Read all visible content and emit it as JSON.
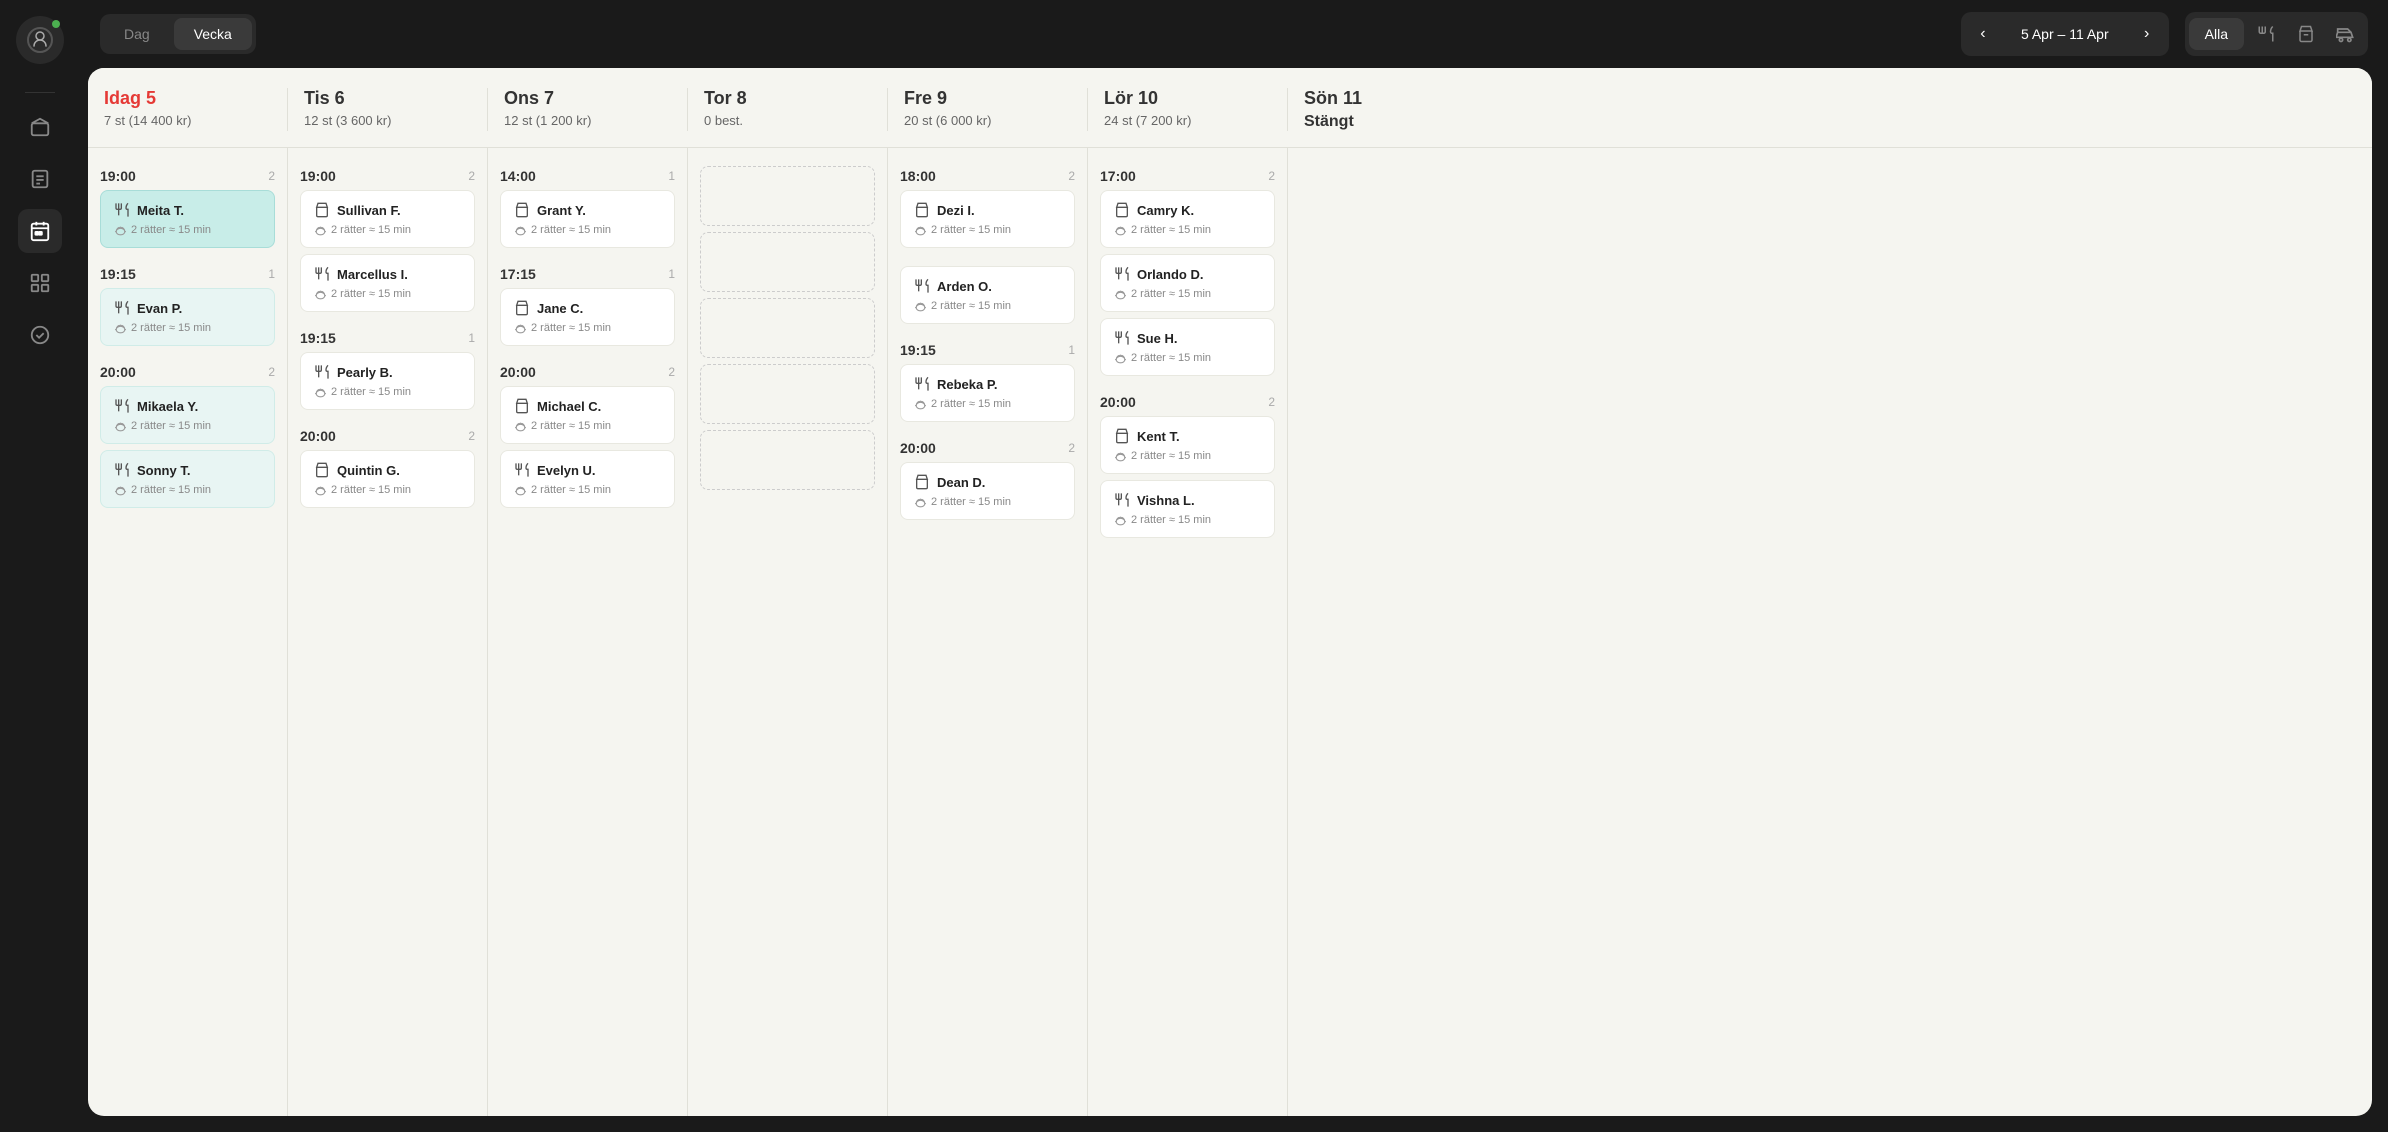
{
  "sidebar": {
    "logo_alt": "App Logo",
    "items": [
      {
        "id": "home",
        "icon": "home",
        "label": "Home",
        "active": false
      },
      {
        "id": "orders",
        "icon": "orders",
        "label": "Orders",
        "active": false
      },
      {
        "id": "calendar",
        "icon": "calendar",
        "label": "Calendar",
        "active": true
      },
      {
        "id": "grid",
        "icon": "grid",
        "label": "Grid",
        "active": false
      },
      {
        "id": "tasks",
        "icon": "tasks",
        "label": "Tasks",
        "active": false
      }
    ]
  },
  "topbar": {
    "view_dag": "Dag",
    "view_vecka": "Vecka",
    "date_range": "5 Apr – 11 Apr",
    "nav_prev": "‹",
    "nav_next": "›",
    "filter_alla": "Alla"
  },
  "days": [
    {
      "id": "mon",
      "name": "Idag 5",
      "today": true,
      "stats": "7 st (14 400 kr)",
      "slots": [
        {
          "time": "19:00",
          "count": 2,
          "reservations": [
            {
              "name": "Meita T.",
              "details": "2 rätter ≈ 15 min",
              "icon": "cutlery",
              "style": "highlighted"
            }
          ]
        },
        {
          "time": "19:15",
          "count": 1,
          "reservations": [
            {
              "name": "Evan P.",
              "details": "2 rätter ≈ 15 min",
              "icon": "cutlery",
              "style": "teal"
            }
          ]
        },
        {
          "time": "20:00",
          "count": 2,
          "reservations": [
            {
              "name": "Mikaela Y.",
              "details": "2 rätter ≈ 15 min",
              "icon": "cutlery",
              "style": "teal"
            },
            {
              "name": "Sonny T.",
              "details": "2 rätter ≈ 15 min",
              "icon": "cutlery",
              "style": "teal"
            }
          ]
        }
      ]
    },
    {
      "id": "tue",
      "name": "Tis 6",
      "today": false,
      "stats": "12 st (3 600 kr)",
      "slots": [
        {
          "time": "19:00",
          "count": 2,
          "reservations": [
            {
              "name": "Sullivan F.",
              "details": "2 rätter ≈ 15 min",
              "icon": "bag",
              "style": "default"
            },
            {
              "name": "Marcellus I.",
              "details": "2 rätter ≈ 15 min",
              "icon": "cutlery",
              "style": "default"
            }
          ]
        },
        {
          "time": "19:15",
          "count": 1,
          "reservations": [
            {
              "name": "Pearly B.",
              "details": "2 rätter ≈ 15 min",
              "icon": "cutlery",
              "style": "default"
            }
          ]
        },
        {
          "time": "20:00",
          "count": 2,
          "reservations": [
            {
              "name": "Quintin G.",
              "details": "2 rätter ≈ 15 min",
              "icon": "bag",
              "style": "default"
            }
          ]
        }
      ]
    },
    {
      "id": "wed",
      "name": "Ons 7",
      "today": false,
      "stats": "12 st (1 200 kr)",
      "slots": [
        {
          "time": "14:00",
          "count": 1,
          "reservations": [
            {
              "name": "Grant Y.",
              "details": "2 rätter ≈ 15 min",
              "icon": "bag",
              "style": "default"
            }
          ]
        },
        {
          "time": "17:15",
          "count": 1,
          "reservations": [
            {
              "name": "Jane C.",
              "details": "2 rätter ≈ 15 min",
              "icon": "bag",
              "style": "default"
            }
          ]
        },
        {
          "time": "20:00",
          "count": 2,
          "reservations": [
            {
              "name": "Michael C.",
              "details": "2 rätter ≈ 15 min",
              "icon": "bag",
              "style": "default"
            },
            {
              "name": "Evelyn U.",
              "details": "2 rätter ≈ 15 min",
              "icon": "cutlery",
              "style": "default"
            }
          ]
        }
      ]
    },
    {
      "id": "thu",
      "name": "Tor 8",
      "today": false,
      "stats": "0 best.",
      "slots": []
    },
    {
      "id": "fri",
      "name": "Fre 9",
      "today": false,
      "stats": "20 st (6 000 kr)",
      "slots": [
        {
          "time": "18:00",
          "count": 2,
          "reservations": [
            {
              "name": "Dezi I.",
              "details": "2 rätter ≈ 15 min",
              "icon": "bag",
              "style": "default"
            }
          ]
        },
        {
          "time": null,
          "count": null,
          "reservations": [
            {
              "name": "Arden O.",
              "details": "2 rätter ≈ 15 min",
              "icon": "cutlery",
              "style": "default"
            }
          ]
        },
        {
          "time": "19:15",
          "count": 1,
          "reservations": [
            {
              "name": "Rebeka P.",
              "details": "2 rätter ≈ 15 min",
              "icon": "cutlery",
              "style": "default"
            }
          ]
        },
        {
          "time": "20:00",
          "count": 2,
          "reservations": [
            {
              "name": "Dean D.",
              "details": "2 rätter ≈ 15 min",
              "icon": "bag",
              "style": "default"
            }
          ]
        }
      ]
    },
    {
      "id": "sat",
      "name": "Lör 10",
      "today": false,
      "stats": "24 st (7 200 kr)",
      "slots": [
        {
          "time": "17:00",
          "count": 2,
          "reservations": [
            {
              "name": "Camry K.",
              "details": "2 rätter ≈ 15 min",
              "icon": "bag",
              "style": "default"
            },
            {
              "name": "Orlando D.",
              "details": "2 rätter ≈ 15 min",
              "icon": "cutlery",
              "style": "default"
            },
            {
              "name": "Sue H.",
              "details": "2 rätter ≈ 15 min",
              "icon": "cutlery",
              "style": "default"
            }
          ]
        },
        {
          "time": "20:00",
          "count": 2,
          "reservations": [
            {
              "name": "Kent T.",
              "details": "2 rätter ≈ 15 min",
              "icon": "bag",
              "style": "default"
            },
            {
              "name": "Vishna L.",
              "details": "2 rätter ≈ 15 min",
              "icon": "cutlery",
              "style": "default"
            }
          ]
        }
      ]
    },
    {
      "id": "sun",
      "name": "Sön 11",
      "today": false,
      "stats": "Stängt",
      "closed": true,
      "slots": []
    }
  ]
}
